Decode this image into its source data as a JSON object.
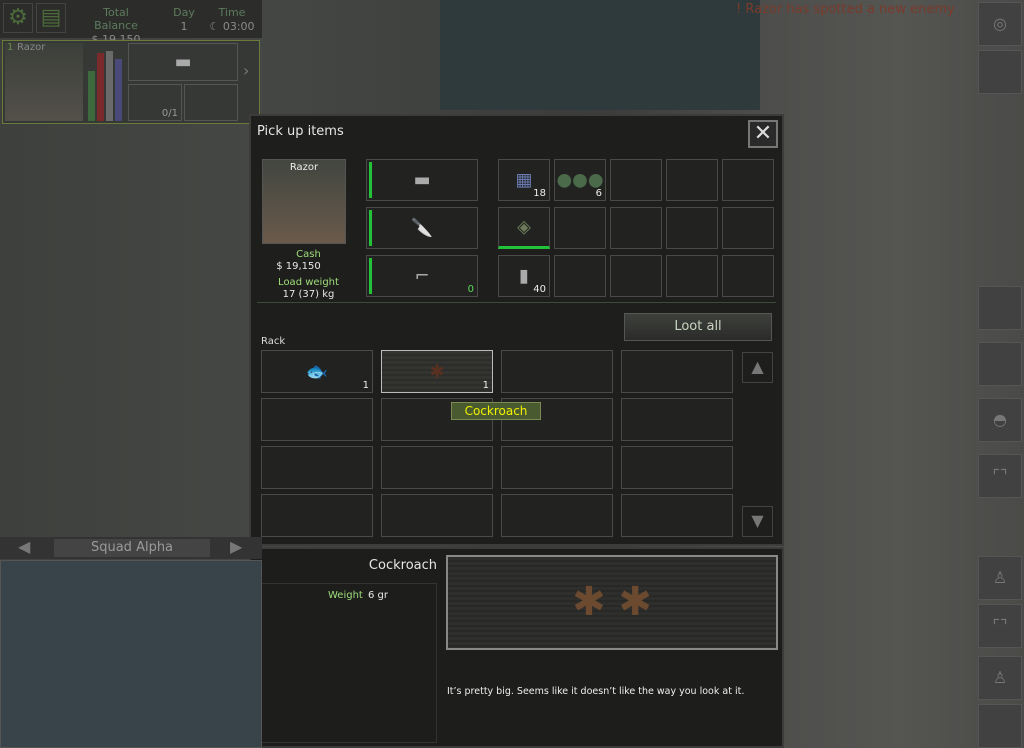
{
  "hud": {
    "balance_label": "Total Balance",
    "balance": "$ 19,150",
    "day_label": "Day",
    "day": "1",
    "time_label": "Time",
    "time": "☾ 03:00",
    "icons": [
      "gear-icon",
      "laptop-icon"
    ]
  },
  "merc_card": {
    "index": "1",
    "name": "Razor",
    "ammo": "0/1"
  },
  "alert": {
    "mark": "!",
    "text": "Razor has spotted a new enemy"
  },
  "pickup": {
    "title": "Pick up items",
    "close": "✕",
    "merc": {
      "name": "Razor",
      "cash_label": "Cash",
      "cash": "$ 19,150",
      "load_label": "Load weight",
      "load": "17 (37) kg"
    },
    "weapons": [
      {
        "icon": "machete",
        "count": ""
      },
      {
        "icon": "combat-knife",
        "count": ""
      },
      {
        "icon": "pistol",
        "count": "0"
      }
    ],
    "inventory": [
      {
        "icon": "357-magnum-ammo-box",
        "count": "18"
      },
      {
        "icon": "grenades",
        "count": "6"
      },
      {
        "icon": "timed-explosive",
        "count": ""
      },
      {
        "icon": "pistol-magazine",
        "count": "40"
      }
    ],
    "loot_all": "Loot all",
    "rack_label": "Rack",
    "rack_items": [
      {
        "icon": "fish",
        "count": "1"
      },
      {
        "icon": "cockroach",
        "count": "1"
      }
    ],
    "tooltip": "Cockroach"
  },
  "detail": {
    "name": "Cockroach",
    "weight_label": "Weight",
    "weight": "6 gr",
    "description": "It’s pretty big. Seems like it doesn’t like the way you look at it."
  },
  "squad": {
    "name": "Squad Alpha"
  },
  "colors": {
    "accent_green": "#22c33a",
    "tooltip_text": "#f0f000",
    "alert": "#7a3a2a"
  }
}
